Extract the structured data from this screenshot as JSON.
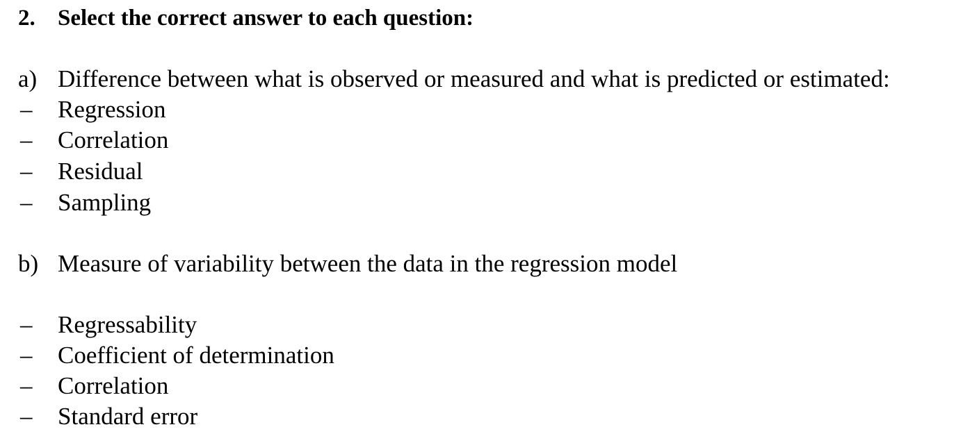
{
  "heading": {
    "number": "2.",
    "text": "Select the correct answer to each question:"
  },
  "questions": [
    {
      "label": "a)",
      "text": "Difference between what is observed or measured and what is predicted or estimated:",
      "options": [
        "Regression",
        "Correlation",
        "Residual",
        "Sampling"
      ]
    },
    {
      "label": "b)",
      "text": "Measure of variability between the data in the regression model",
      "options": [
        "Regressability",
        "Coefficient of determination",
        "Correlation",
        "Standard error"
      ]
    }
  ],
  "bullet": "–"
}
